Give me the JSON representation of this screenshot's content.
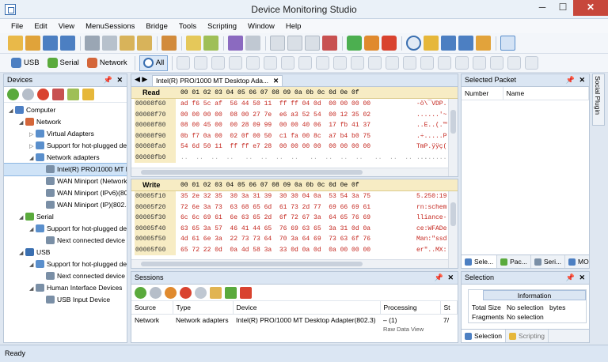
{
  "window": {
    "title": "Device Monitoring Studio",
    "min": "─",
    "max": "☐",
    "close": "✕"
  },
  "menu": [
    "File",
    "Edit",
    "View",
    "MenuSessions",
    "Bridge",
    "Tools",
    "Scripting",
    "Window",
    "Help"
  ],
  "toolbar2": {
    "usb": "USB",
    "serial": "Serial",
    "network": "Network",
    "all": "All"
  },
  "devices": {
    "title": "Devices",
    "pin": "📌",
    "close": "✕",
    "tree": [
      {
        "label": "Computer",
        "depth": 0,
        "toggle": "◢",
        "color": "#4d7fc4"
      },
      {
        "label": "Network",
        "depth": 1,
        "toggle": "◢",
        "color": "#d4663a"
      },
      {
        "label": "Virtual Adapters",
        "depth": 2,
        "toggle": "▷",
        "color": "#5a8fcc"
      },
      {
        "label": "Support for hot-plugged devic",
        "depth": 2,
        "toggle": "▷",
        "color": "#5a8fcc"
      },
      {
        "label": "Network adapters",
        "depth": 2,
        "toggle": "◢",
        "color": "#5a8fcc"
      },
      {
        "label": "Intel(R) PRO/1000 MT Desk",
        "depth": 3,
        "toggle": "",
        "color": "#7a8fa6",
        "selected": true
      },
      {
        "label": "WAN Miniport (Network Mor",
        "depth": 3,
        "toggle": "",
        "color": "#7a8fa6"
      },
      {
        "label": "WAN Miniport (IPv6)(802.3)",
        "depth": 3,
        "toggle": "",
        "color": "#7a8fa6"
      },
      {
        "label": "WAN Miniport (IP)(802.3)",
        "depth": 3,
        "toggle": "",
        "color": "#7a8fa6"
      },
      {
        "label": "Serial",
        "depth": 1,
        "toggle": "◢",
        "color": "#5aaa3c"
      },
      {
        "label": "Support for hot-plugged devic",
        "depth": 2,
        "toggle": "◢",
        "color": "#5a8fcc"
      },
      {
        "label": "Next connected device",
        "depth": 3,
        "toggle": "",
        "color": "#7a8fa6"
      },
      {
        "label": "USB",
        "depth": 1,
        "toggle": "◢",
        "color": "#3a6fb0"
      },
      {
        "label": "Support for hot-plugged devic",
        "depth": 2,
        "toggle": "◢",
        "color": "#5a8fcc"
      },
      {
        "label": "Next connected device",
        "depth": 3,
        "toggle": "",
        "color": "#7a8fa6"
      },
      {
        "label": "Human Interface Devices",
        "depth": 2,
        "toggle": "◢",
        "color": "#7a8fa6"
      },
      {
        "label": "USB Input Device",
        "depth": 3,
        "toggle": "",
        "color": "#7a8fa6"
      }
    ]
  },
  "editor": {
    "nav": "◀ ▶",
    "tab_label": "Intel(R) PRO/1000 MT Desktop Ada...",
    "tab_close": "✕",
    "read": {
      "label": "Read",
      "columns": "00 01 02 03  04 05 06 07  08 09 0a 0b  0c 0d 0e 0f",
      "rows": [
        {
          "offset": "00008f60",
          "bytes": "ad f6 5c af  56 44 50 11  ff ff 04 0d  00 00 00 00",
          "ascii": "-ö\\¯VDP."
        },
        {
          "offset": "00008f70",
          "bytes": "00 00 00 00  08 00 27 7e  e6 a3 52 54  00 12 35 02",
          "ascii": "......'~"
        },
        {
          "offset": "00008f80",
          "bytes": "08 00 45 00  00 28 09 99  00 00 40 06  17 fb 41 37",
          "ascii": "..E..(.™"
        },
        {
          "offset": "00008f90",
          "bytes": "0b f7 0a 00  02 0f 00 50  c1 fa 00 8c  a7 b4 b0 75",
          "ascii": ".÷.....P"
        },
        {
          "offset": "00008fa0",
          "bytes": "54 6d 50 11  ff ff e7 28  00 00 00 00  00 00 00 00",
          "ascii": "TmP.ÿÿç("
        },
        {
          "offset": "00008fb0",
          "bytes": "..  ..  ..  ..   ..  ..  ..  ..   ..  ..  ..  ..   ..  ..  ..  ..",
          "ascii": "........",
          "gray": true
        }
      ]
    },
    "write": {
      "label": "Write",
      "columns": "00 01 02 03  04 05 06 07  08 09 0a 0b  0c 0d 0e 0f",
      "rows": [
        {
          "offset": "00005f10",
          "bytes": "35 2e 32 35  30 3a 31 39  30 30 04 0a  53 54 3a 75",
          "ascii": "5.250:19"
        },
        {
          "offset": "00005f20",
          "bytes": "72 6e 3a 73  63 68 65 6d  61 73 2d 77  69 66 69 61",
          "ascii": "rn:schem"
        },
        {
          "offset": "00005f30",
          "bytes": "6c 6c 69 61  6e 63 65 2d  6f 72 67 3a  64 65 76 69",
          "ascii": "lliance-"
        },
        {
          "offset": "00005f40",
          "bytes": "63 65 3a 57  46 41 44 65  76 69 63 65  3a 31 0d 0a",
          "ascii": "ce:WFADe"
        },
        {
          "offset": "00005f50",
          "bytes": "4d 61 6e 3a  22 73 73 64  70 3a 64 69  73 63 6f 76",
          "ascii": "Man:\"ssd"
        },
        {
          "offset": "00005f60",
          "bytes": "65 72 22 0d  0a 4d 58 3a  33 0d 0a 0d  0a 00 00 00",
          "ascii": "er\"..MX:"
        }
      ]
    }
  },
  "selected_packet": {
    "title": "Selected Packet",
    "columns": [
      "Number",
      "Name"
    ],
    "tabs": [
      "Sele...",
      "Pac...",
      "Seri...",
      "MO..."
    ]
  },
  "side_tab": "Social Plugin",
  "sessions": {
    "title": "Sessions",
    "columns": [
      "Source",
      "Type",
      "Device",
      "Processing",
      "St"
    ],
    "rows": [
      {
        "source": "Network",
        "type": "Network adapters",
        "device": "Intel(R) PRO/1000 MT Desktop Adapter(802.3)",
        "processing": "– (1)",
        "status": "7/"
      },
      {
        "source": "",
        "type": "",
        "device": "",
        "processing": "Raw Data View",
        "status": ""
      }
    ]
  },
  "selection": {
    "title": "Selection",
    "info_header": "Information",
    "total_size_label": "Total Size",
    "total_size_value": "No selection",
    "total_size_unit": "bytes",
    "fragments_label": "Fragments",
    "fragments_value": "No selection",
    "tabs": [
      "Selection",
      "Scripting"
    ]
  },
  "status": {
    "text": "Ready"
  }
}
